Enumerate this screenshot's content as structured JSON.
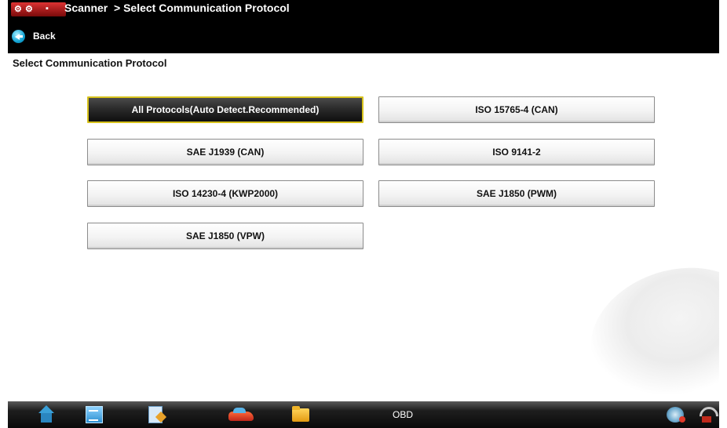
{
  "header": {
    "app_name": "Scanner",
    "breadcrumb": "> Select Communication Protocol",
    "back_label": "Back"
  },
  "page": {
    "title": "Select Communication Protocol"
  },
  "protocols": [
    {
      "label": "All Protocols(Auto Detect.Recommended)",
      "selected": true
    },
    {
      "label": "ISO 15765-4 (CAN)",
      "selected": false
    },
    {
      "label": "SAE J1939 (CAN)",
      "selected": false
    },
    {
      "label": "ISO 9141-2",
      "selected": false
    },
    {
      "label": "ISO 14230-4 (KWP2000)",
      "selected": false
    },
    {
      "label": "SAE J1850 (PWM)",
      "selected": false
    },
    {
      "label": "SAE J1850 (VPW)",
      "selected": false
    }
  ],
  "taskbar": {
    "vehicle_label": "OBD",
    "icons": [
      "home-icon",
      "doc-icon",
      "note-icon",
      "car-icon",
      "folder-icon",
      "connection-icon",
      "signal-icon"
    ]
  },
  "colors": {
    "selected_border": "#d7c21c",
    "selected_fill": "#1a1a1a",
    "topbar": "#000000"
  }
}
